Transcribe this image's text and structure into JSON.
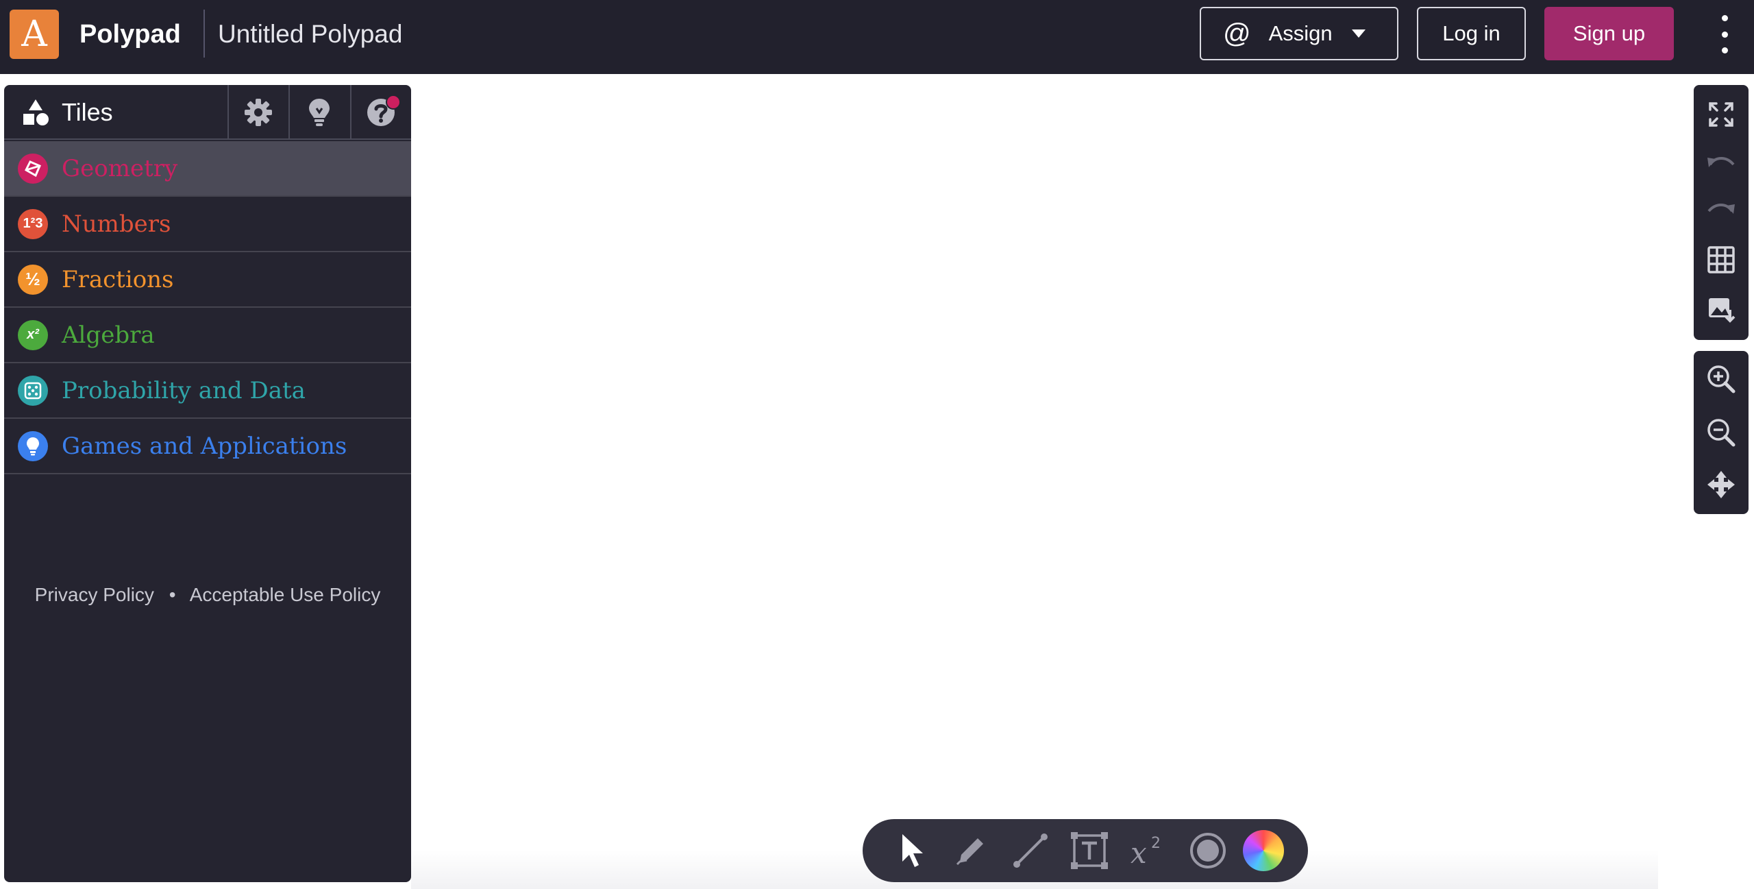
{
  "header": {
    "logo_letter": "A",
    "app_name": "Polypad",
    "doc_title": "Untitled Polypad",
    "assign_label": "Assign",
    "assign_symbol": "@",
    "login_label": "Log in",
    "signup_label": "Sign up"
  },
  "sidebar": {
    "tab_label": "Tiles",
    "categories": [
      {
        "label": "Geometry",
        "color": "#cd2062",
        "icon": "polygon-icon",
        "active": true
      },
      {
        "label": "Numbers",
        "color": "#e0523a",
        "icon": "numbers-icon",
        "glyph": "1²3"
      },
      {
        "label": "Fractions",
        "color": "#f2932d",
        "icon": "fraction-icon",
        "glyph": "½"
      },
      {
        "label": "Algebra",
        "color": "#4caa3d",
        "icon": "algebra-icon",
        "glyph": "x²"
      },
      {
        "label": "Probability and Data",
        "color": "#2fa5a9",
        "icon": "dice-icon"
      },
      {
        "label": "Games and Applications",
        "color": "#3b80ee",
        "icon": "lightbulb-icon"
      }
    ],
    "footer": {
      "privacy": "Privacy Policy",
      "separator": "•",
      "aup": "Acceptable Use Policy"
    }
  },
  "colors": {
    "topbar": "#22212d",
    "sidebar": "#252430",
    "signup": "#a12a6b",
    "logo": "#e8823a"
  }
}
